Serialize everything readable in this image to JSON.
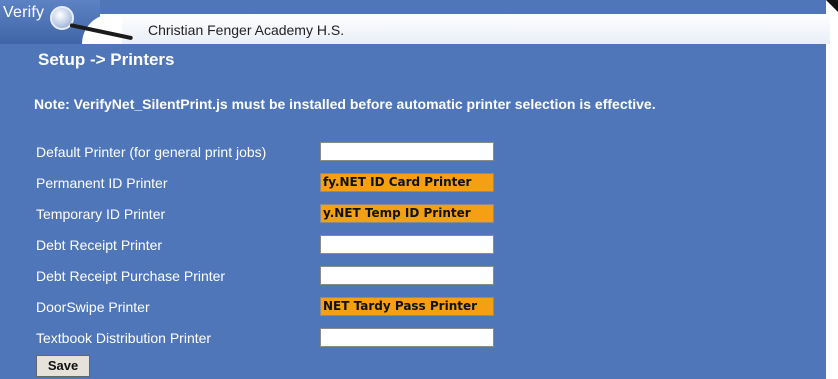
{
  "header": {
    "logo": "Verify",
    "school_name": "Christian Fenger Academy H.S."
  },
  "page_title": "Setup -> Printers",
  "note": "Note: VerifyNet_SilentPrint.js must be installed before automatic printer selection is effective.",
  "printers": [
    {
      "label": "Default Printer (for general print jobs)",
      "value": ""
    },
    {
      "label": "Permanent ID Printer",
      "value": "fy.NET ID Card Printer"
    },
    {
      "label": "Temporary ID Printer",
      "value": "y.NET Temp ID Printer"
    },
    {
      "label": "Debt Receipt Printer",
      "value": ""
    },
    {
      "label": "Debt Receipt Purchase Printer",
      "value": ""
    },
    {
      "label": "DoorSwipe Printer",
      "value": "NET Tardy Pass Printer"
    },
    {
      "label": "Textbook Distribution Printer",
      "value": ""
    }
  ],
  "save_label": "Save",
  "colors": {
    "panel": "#4f76b9",
    "filled_field": "#f5a012"
  }
}
